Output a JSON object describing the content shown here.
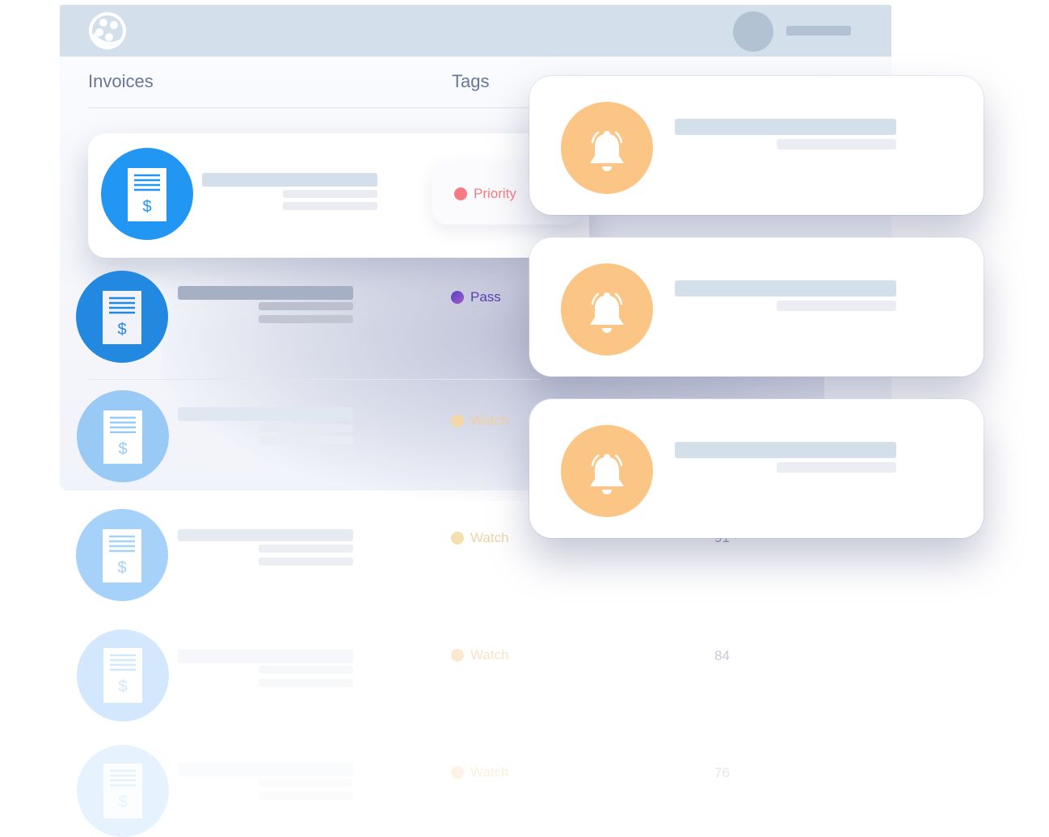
{
  "header": {
    "logo_icon": "film-reel-logo-icon",
    "user_avatar_icon": "user-avatar-icon"
  },
  "table": {
    "columns": [
      "Invoices",
      "Tags"
    ],
    "rows": [
      {
        "icon": "invoice-dollar-icon",
        "tag": "Priority",
        "tag_color": "#f47b82",
        "tag_dot_color": "#f47b82",
        "score": "",
        "selected": true
      },
      {
        "icon": "invoice-dollar-icon",
        "tag": "Pass",
        "tag_color": "#5b3fb0",
        "tag_dot_color": "#7b4fc9",
        "score": ""
      },
      {
        "icon": "invoice-dollar-icon",
        "tag": "Watch",
        "tag_color": "#f3cfa0",
        "tag_dot_color": "#f3d7a6",
        "score": ""
      },
      {
        "icon": "invoice-dollar-icon",
        "tag": "Watch",
        "tag_color": "#f3cfa0",
        "tag_dot_color": "#f6dfae",
        "score": "91"
      },
      {
        "icon": "invoice-dollar-icon",
        "tag": "Watch",
        "tag_color": "#f8e0c4",
        "tag_dot_color": "#fbe8d0",
        "score": "84"
      },
      {
        "icon": "invoice-dollar-icon",
        "tag": "Watch",
        "tag_color": "#fcefe0",
        "tag_dot_color": "#fdf2e4",
        "score": "76"
      }
    ]
  },
  "notifications": [
    {
      "icon": "bell-icon",
      "accent": "#fbc685"
    },
    {
      "icon": "bell-icon",
      "accent": "#fbc685"
    },
    {
      "icon": "bell-icon",
      "accent": "#fbc685"
    }
  ],
  "colors": {
    "header_bg": "#d3dfeb",
    "invoice_blue": "#2196f3",
    "bell_orange": "#fbc685"
  }
}
